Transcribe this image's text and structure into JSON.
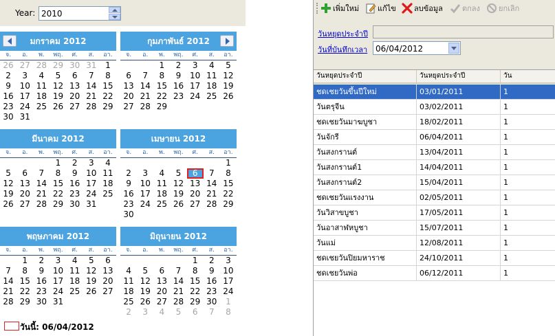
{
  "year_selector": {
    "label": "Year:",
    "value": "2010"
  },
  "weekdays": [
    "จ.",
    "อ.",
    "พ.",
    "พฤ.",
    "ศ.",
    "ส.",
    "อา."
  ],
  "calendars": [
    {
      "title": "มกราคม 2012",
      "has_prev": true,
      "has_next": false,
      "days": [
        [
          26,
          1
        ],
        [
          27,
          1
        ],
        [
          28,
          1
        ],
        [
          29,
          1
        ],
        [
          30,
          1
        ],
        [
          31,
          1
        ],
        [
          1,
          0
        ],
        [
          2,
          0
        ],
        [
          3,
          0
        ],
        [
          4,
          0
        ],
        [
          5,
          0
        ],
        [
          6,
          0
        ],
        [
          7,
          0
        ],
        [
          8,
          0
        ],
        [
          9,
          0
        ],
        [
          10,
          0
        ],
        [
          11,
          0
        ],
        [
          12,
          0
        ],
        [
          13,
          0
        ],
        [
          14,
          0
        ],
        [
          15,
          0
        ],
        [
          16,
          0
        ],
        [
          17,
          0
        ],
        [
          18,
          0
        ],
        [
          19,
          0
        ],
        [
          20,
          0
        ],
        [
          21,
          0
        ],
        [
          22,
          0
        ],
        [
          23,
          0
        ],
        [
          24,
          0
        ],
        [
          25,
          0
        ],
        [
          26,
          0
        ],
        [
          27,
          0
        ],
        [
          28,
          0
        ],
        [
          29,
          0
        ],
        [
          30,
          0
        ],
        [
          31,
          0
        ]
      ]
    },
    {
      "title": "กุมภาพันธ์ 2012",
      "has_prev": false,
      "has_next": true,
      "days": [
        [
          0,
          2
        ],
        [
          0,
          2
        ],
        [
          1,
          0
        ],
        [
          2,
          0
        ],
        [
          3,
          0
        ],
        [
          4,
          0
        ],
        [
          5,
          0
        ],
        [
          6,
          0
        ],
        [
          7,
          0
        ],
        [
          8,
          0
        ],
        [
          9,
          0
        ],
        [
          10,
          0
        ],
        [
          11,
          0
        ],
        [
          12,
          0
        ],
        [
          13,
          0
        ],
        [
          14,
          0
        ],
        [
          15,
          0
        ],
        [
          16,
          0
        ],
        [
          17,
          0
        ],
        [
          18,
          0
        ],
        [
          19,
          0
        ],
        [
          20,
          0
        ],
        [
          21,
          0
        ],
        [
          22,
          0
        ],
        [
          23,
          0
        ],
        [
          24,
          0
        ],
        [
          25,
          0
        ],
        [
          26,
          0
        ],
        [
          27,
          0
        ],
        [
          28,
          0
        ],
        [
          29,
          0
        ]
      ]
    },
    {
      "title": "มีนาคม 2012",
      "has_prev": false,
      "has_next": false,
      "days": [
        [
          0,
          2
        ],
        [
          0,
          2
        ],
        [
          0,
          2
        ],
        [
          1,
          0
        ],
        [
          2,
          0
        ],
        [
          3,
          0
        ],
        [
          4,
          0
        ],
        [
          5,
          0
        ],
        [
          6,
          0
        ],
        [
          7,
          0
        ],
        [
          8,
          0
        ],
        [
          9,
          0
        ],
        [
          10,
          0
        ],
        [
          11,
          0
        ],
        [
          12,
          0
        ],
        [
          13,
          0
        ],
        [
          14,
          0
        ],
        [
          15,
          0
        ],
        [
          16,
          0
        ],
        [
          17,
          0
        ],
        [
          18,
          0
        ],
        [
          19,
          0
        ],
        [
          20,
          0
        ],
        [
          21,
          0
        ],
        [
          22,
          0
        ],
        [
          23,
          0
        ],
        [
          24,
          0
        ],
        [
          25,
          0
        ],
        [
          26,
          0
        ],
        [
          27,
          0
        ],
        [
          28,
          0
        ],
        [
          29,
          0
        ],
        [
          30,
          0
        ],
        [
          31,
          0
        ]
      ]
    },
    {
      "title": "เมษายน 2012",
      "has_prev": false,
      "has_next": false,
      "days": [
        [
          0,
          2
        ],
        [
          0,
          2
        ],
        [
          0,
          2
        ],
        [
          0,
          2
        ],
        [
          0,
          2
        ],
        [
          0,
          2
        ],
        [
          1,
          0
        ],
        [
          2,
          0
        ],
        [
          3,
          0
        ],
        [
          4,
          0
        ],
        [
          5,
          0
        ],
        [
          6,
          3
        ],
        [
          7,
          0
        ],
        [
          8,
          0
        ],
        [
          9,
          0
        ],
        [
          10,
          0
        ],
        [
          11,
          0
        ],
        [
          12,
          0
        ],
        [
          13,
          0
        ],
        [
          14,
          0
        ],
        [
          15,
          0
        ],
        [
          16,
          0
        ],
        [
          17,
          0
        ],
        [
          18,
          0
        ],
        [
          19,
          0
        ],
        [
          20,
          0
        ],
        [
          21,
          0
        ],
        [
          22,
          0
        ],
        [
          23,
          0
        ],
        [
          24,
          0
        ],
        [
          25,
          0
        ],
        [
          26,
          0
        ],
        [
          27,
          0
        ],
        [
          28,
          0
        ],
        [
          29,
          0
        ],
        [
          30,
          0
        ]
      ]
    },
    {
      "title": "พฤษภาคม 2012",
      "has_prev": false,
      "has_next": false,
      "days": [
        [
          0,
          2
        ],
        [
          1,
          0
        ],
        [
          2,
          0
        ],
        [
          3,
          0
        ],
        [
          4,
          0
        ],
        [
          5,
          0
        ],
        [
          6,
          0
        ],
        [
          7,
          0
        ],
        [
          8,
          0
        ],
        [
          9,
          0
        ],
        [
          10,
          0
        ],
        [
          11,
          0
        ],
        [
          12,
          0
        ],
        [
          13,
          0
        ],
        [
          14,
          0
        ],
        [
          15,
          0
        ],
        [
          16,
          0
        ],
        [
          17,
          0
        ],
        [
          18,
          0
        ],
        [
          19,
          0
        ],
        [
          20,
          0
        ],
        [
          21,
          0
        ],
        [
          22,
          0
        ],
        [
          23,
          0
        ],
        [
          24,
          0
        ],
        [
          25,
          0
        ],
        [
          26,
          0
        ],
        [
          27,
          0
        ],
        [
          28,
          0
        ],
        [
          29,
          0
        ],
        [
          30,
          0
        ],
        [
          31,
          0
        ]
      ]
    },
    {
      "title": "มิถุนายน 2012",
      "has_prev": false,
      "has_next": false,
      "days": [
        [
          0,
          2
        ],
        [
          0,
          2
        ],
        [
          0,
          2
        ],
        [
          0,
          2
        ],
        [
          1,
          0
        ],
        [
          2,
          0
        ],
        [
          3,
          0
        ],
        [
          4,
          0
        ],
        [
          5,
          0
        ],
        [
          6,
          0
        ],
        [
          7,
          0
        ],
        [
          8,
          0
        ],
        [
          9,
          0
        ],
        [
          10,
          0
        ],
        [
          11,
          0
        ],
        [
          12,
          0
        ],
        [
          13,
          0
        ],
        [
          14,
          0
        ],
        [
          15,
          0
        ],
        [
          16,
          0
        ],
        [
          17,
          0
        ],
        [
          18,
          0
        ],
        [
          19,
          0
        ],
        [
          20,
          0
        ],
        [
          21,
          0
        ],
        [
          22,
          0
        ],
        [
          23,
          0
        ],
        [
          24,
          0
        ],
        [
          25,
          0
        ],
        [
          26,
          0
        ],
        [
          27,
          0
        ],
        [
          28,
          0
        ],
        [
          29,
          0
        ],
        [
          30,
          0
        ],
        [
          1,
          1
        ],
        [
          2,
          1
        ],
        [
          3,
          1
        ],
        [
          4,
          1
        ],
        [
          5,
          1
        ],
        [
          6,
          1
        ],
        [
          7,
          1
        ],
        [
          8,
          1
        ]
      ]
    }
  ],
  "today": {
    "text": "วันนี้: 06/04/2012"
  },
  "toolbar": {
    "add_label": "เพิ่มใหม่",
    "edit_label": "แก้ไข",
    "delete_label": "ลบข้อมูล",
    "ok_label": "ตกลง",
    "cancel_label": "ยกเลิก"
  },
  "form": {
    "holiday_name_label": "วันหยุดประจำปี",
    "holiday_name_value": "",
    "record_date_label": "วันที่บันทึกเวลา",
    "record_date_value": "06/04/2012"
  },
  "grid": {
    "columns": [
      "วันหยุดประจำปี",
      "วันหยุดประจำปี",
      "วัน"
    ],
    "rows": [
      [
        "ชดเชยวันขึ้นปีใหม่",
        "03/01/2011",
        "1"
      ],
      [
        "วันตรุจีน",
        "03/02/2011",
        "1"
      ],
      [
        "ชดเชยวันมาฆบูชา",
        "18/02/2011",
        "1"
      ],
      [
        "วันจักรี",
        "06/04/2011",
        "1"
      ],
      [
        "วันสงกรานต์",
        "13/04/2011",
        "1"
      ],
      [
        "วันสงกรานต์1",
        "14/04/2011",
        "1"
      ],
      [
        "วันสงกรานต์2",
        "15/04/2011",
        "1"
      ],
      [
        "ชดเชยวันแรงงาน",
        "02/05/2011",
        "1"
      ],
      [
        "วันวิสาขบูชา",
        "17/05/2011",
        "1"
      ],
      [
        "วันอาสาฬหบูชา",
        "15/07/2011",
        "1"
      ],
      [
        "วันแม่",
        "12/08/2011",
        "1"
      ],
      [
        "ชดเชยวันปิยมหาราช",
        "24/10/2011",
        "1"
      ],
      [
        "ชดเชยวันพ่อ",
        "06/12/2011",
        "1"
      ]
    ],
    "selected_row": 0
  },
  "colors": {
    "calendar_header": "#4ba3e0",
    "selected_row": "#316ac5",
    "today_marker": "#e02020",
    "panel_bg": "#ebe9de"
  }
}
